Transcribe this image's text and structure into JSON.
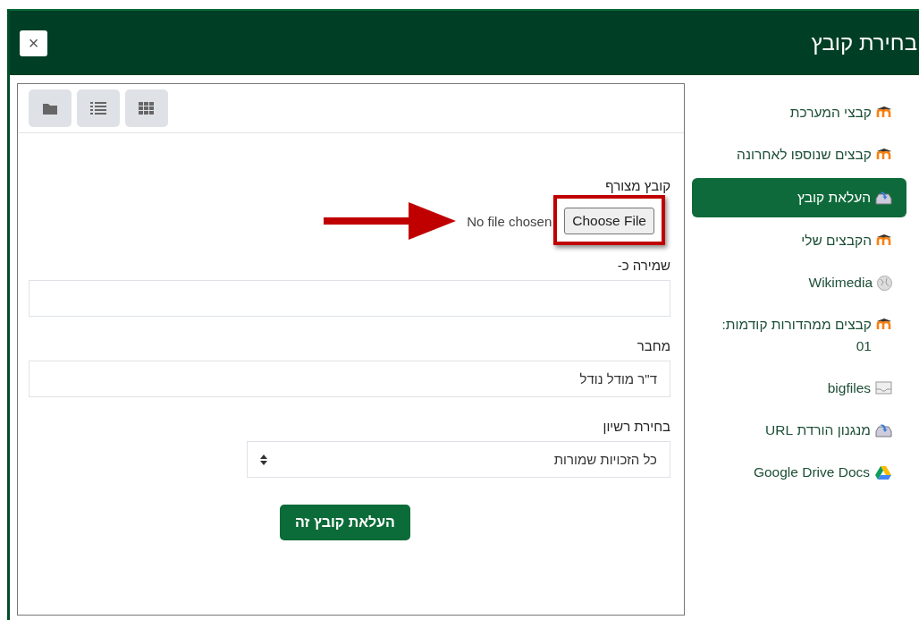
{
  "dialog": {
    "title": "בחירת קובץ",
    "close_label": "×"
  },
  "sidebar": {
    "items": [
      {
        "label": "קבצי המערכת",
        "kind": "moodle",
        "selected": false
      },
      {
        "label": "קבצים שנוספו לאחרונה",
        "kind": "moodle",
        "selected": false
      },
      {
        "label": "העלאת קובץ",
        "kind": "upload",
        "selected": true
      },
      {
        "label": "הקבצים שלי",
        "kind": "moodle",
        "selected": false
      },
      {
        "label": "Wikimedia",
        "kind": "wikimedia",
        "selected": false
      },
      {
        "label": "קבצים ממהדורות קודמות: 01",
        "kind": "moodle",
        "selected": false
      },
      {
        "label": "bigfiles",
        "kind": "box",
        "selected": false
      },
      {
        "label": "מנגנון הורדת URL",
        "kind": "upload",
        "selected": false
      },
      {
        "label": "Google Drive Docs",
        "kind": "drive",
        "selected": false
      }
    ]
  },
  "form": {
    "fields": [
      {
        "kind": "file",
        "label": "קובץ מצורף",
        "button": "Choose File",
        "status": "No file chosen"
      },
      {
        "kind": "text",
        "label": "שמירה כ-"
      },
      {
        "kind": "text",
        "label": "מחבר",
        "value": "ד\"ר מודל נודל"
      },
      {
        "kind": "select",
        "label": "בחירת רשיון",
        "value": "כל הזכויות שמורות"
      }
    ],
    "submit": "העלאת קובץ זה"
  }
}
